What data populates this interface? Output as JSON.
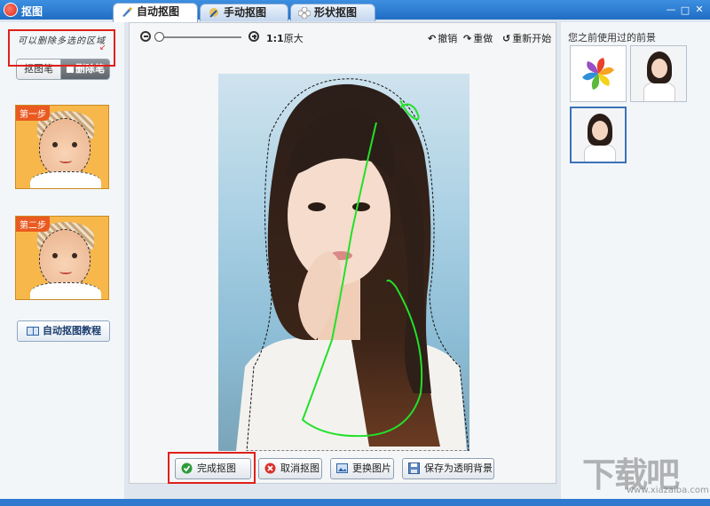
{
  "window": {
    "title": "抠图",
    "minimize": "—",
    "maximize": "□",
    "close": "✕"
  },
  "tabs": [
    {
      "label": "自动抠图",
      "icon": "brush-icon",
      "active": true
    },
    {
      "label": "手动抠图",
      "icon": "hand-brush-icon",
      "active": false
    },
    {
      "label": "形状抠图",
      "icon": "flower-shape-icon",
      "active": false
    }
  ],
  "left_panel": {
    "hint": "可以删除多选的区域",
    "brush_cut_label": "抠图笔",
    "brush_erase_label": "删除笔",
    "step1_label": "第一步",
    "step2_label": "第二步",
    "tutorial_label": "自动抠图教程"
  },
  "toolbar": {
    "ratio_bold": "1:1",
    "ratio_text": "原大",
    "undo_label": "撤销",
    "redo_label": "重做",
    "restart_label": "重新开始",
    "zoom_level": 0
  },
  "bottom_buttons": {
    "finish": "完成抠图",
    "cancel": "取消抠图",
    "replace": "更换图片",
    "save": "保存为透明背景"
  },
  "right_panel": {
    "title": "您之前使用过的前景"
  },
  "watermark": {
    "main": "下载吧",
    "sub": "www.xiazaiba.com"
  },
  "colors": {
    "title_bar": "#1f6dc4",
    "highlight_box": "#e0201a",
    "stroke_green": "#22e02a"
  }
}
